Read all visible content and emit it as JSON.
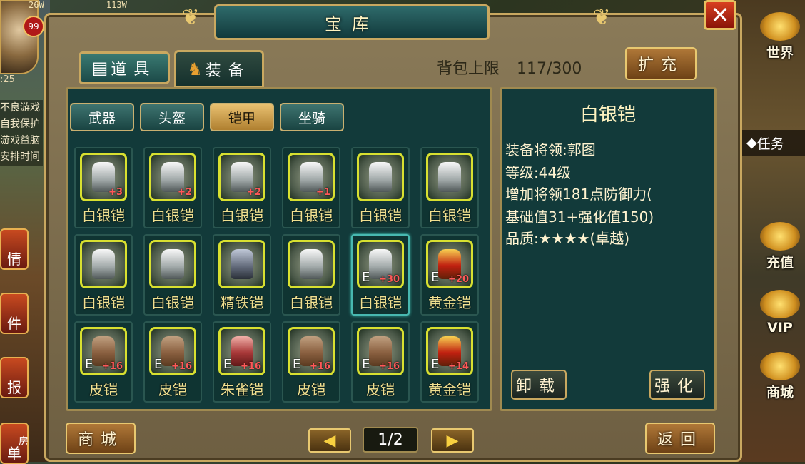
{
  "hud": {
    "res_a": "26W",
    "res_b": "113W",
    "player_level": "99",
    "time_left": ":25",
    "notice": [
      "不良游戏",
      "自我保护",
      "游戏益脑",
      "安排时间"
    ],
    "left_icons": [
      "情",
      "件",
      "报",
      "单"
    ],
    "right_buttons": [
      "世界",
      "充值",
      "VIP",
      "商城"
    ],
    "task_label": "任务",
    "house_label": "房"
  },
  "dialog": {
    "title": "宝库",
    "close_symbol": "✕"
  },
  "tabs": [
    {
      "label": "道具",
      "icon": "book-icon"
    },
    {
      "label": "装备",
      "icon": "helmet-icon"
    }
  ],
  "capacity": {
    "label": "背包上限",
    "value": "117/300"
  },
  "expand_label": "扩充",
  "subtabs": [
    "武器",
    "头盔",
    "铠甲",
    "坐骑"
  ],
  "active_subtab": 2,
  "items": [
    {
      "name": "白银铠",
      "type": "silver",
      "plus": "+3",
      "equipped": false
    },
    {
      "name": "白银铠",
      "type": "silver",
      "plus": "+2",
      "equipped": false
    },
    {
      "name": "白银铠",
      "type": "silver",
      "plus": "+2",
      "equipped": false
    },
    {
      "name": "白银铠",
      "type": "silver",
      "plus": "+1",
      "equipped": false
    },
    {
      "name": "白银铠",
      "type": "silver",
      "plus": "",
      "equipped": false
    },
    {
      "name": "白银铠",
      "type": "silver",
      "plus": "",
      "equipped": false
    },
    {
      "name": "白银铠",
      "type": "silver",
      "plus": "",
      "equipped": false
    },
    {
      "name": "白银铠",
      "type": "silver",
      "plus": "",
      "equipped": false
    },
    {
      "name": "精铁铠",
      "type": "iron",
      "plus": "",
      "equipped": false
    },
    {
      "name": "白银铠",
      "type": "silver",
      "plus": "",
      "equipped": false
    },
    {
      "name": "白银铠",
      "type": "silver",
      "plus": "+30",
      "equipped": true,
      "selected": true
    },
    {
      "name": "黄金铠",
      "type": "gold",
      "plus": "+20",
      "equipped": true
    },
    {
      "name": "皮铠",
      "type": "leather",
      "plus": "+16",
      "equipped": true
    },
    {
      "name": "皮铠",
      "type": "leather",
      "plus": "+16",
      "equipped": true
    },
    {
      "name": "朱雀铠",
      "type": "red",
      "plus": "+16",
      "equipped": true
    },
    {
      "name": "皮铠",
      "type": "leather",
      "plus": "+16",
      "equipped": true
    },
    {
      "name": "皮铠",
      "type": "leather",
      "plus": "+16",
      "equipped": true
    },
    {
      "name": "黄金铠",
      "type": "gold",
      "plus": "+14",
      "equipped": true
    }
  ],
  "equipped_mark": "E",
  "detail": {
    "name": "白银铠",
    "lines": [
      "装备将领:郭图",
      "等级:44级",
      "增加将领181点防御力(",
      "基础值31+强化值150)",
      "品质:★★★★(卓越)"
    ],
    "unequip_label": "卸载",
    "enhance_label": "强化"
  },
  "bottom": {
    "shop_label": "商城",
    "page": "1/2",
    "prev_symbol": "◀",
    "next_symbol": "▶",
    "back_label": "返回"
  }
}
